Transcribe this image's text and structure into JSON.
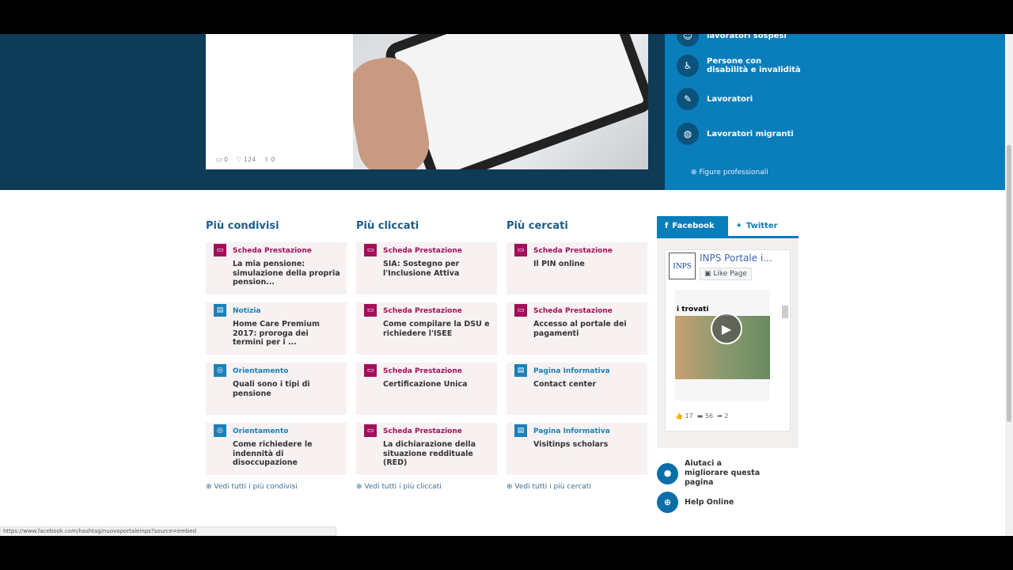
{
  "hero": {
    "social": {
      "comments": "0",
      "likes": "124",
      "shares": "0"
    }
  },
  "categories": [
    {
      "label": "lavoratori sospesi",
      "icon": "people-icon"
    },
    {
      "label": "Persone con disabilità e invalidità",
      "icon": "wheelchair-icon"
    },
    {
      "label": "Lavoratori",
      "icon": "wrench-icon"
    },
    {
      "label": "Lavoratori migranti",
      "icon": "globe-icon"
    }
  ],
  "figure_link": "Figure professionali",
  "columns": [
    {
      "title": "Più condivisi",
      "more": "Vedi tutti i più condivisi",
      "items": [
        {
          "type": "Scheda Prestazione",
          "title": "La mia pensione: simulazione della propria pension..."
        },
        {
          "type": "Notizia",
          "title": "Home Care Premium 2017: proroga dei termini per i ..."
        },
        {
          "type": "Orientamento",
          "title": "Quali sono i tipi di pensione"
        },
        {
          "type": "Orientamento",
          "title": "Come richiedere le indennità di disoccupazione"
        }
      ]
    },
    {
      "title": "Più cliccati",
      "more": "Vedi tutti i più cliccati",
      "items": [
        {
          "type": "Scheda Prestazione",
          "title": "SIA: Sostegno per l'Inclusione Attiva"
        },
        {
          "type": "Scheda Prestazione",
          "title": "Come compilare la DSU e richiedere l'ISEE"
        },
        {
          "type": "Scheda Prestazione",
          "title": "Certificazione Unica"
        },
        {
          "type": "Scheda Prestazione",
          "title": "La dichiarazione della situazione reddituale (RED)"
        }
      ]
    },
    {
      "title": "Più cercati",
      "more": "Vedi tutti i più cercati",
      "items": [
        {
          "type": "Scheda Prestazione",
          "title": "Il PIN online"
        },
        {
          "type": "Scheda Prestazione",
          "title": "Accesso al portale dei pagamenti"
        },
        {
          "type": "Pagina Informativa",
          "title": "Contact center"
        },
        {
          "type": "Pagina Informativa",
          "title": "Visitinps scholars"
        }
      ]
    }
  ],
  "colors": {
    "Scheda Prestazione": "#a2105c",
    "Notizia": "#1a80b8",
    "Orientamento": "#1a80b8",
    "Pagina Informativa": "#1a80b8"
  },
  "social_tabs": {
    "facebook": "Facebook",
    "twitter": "Twitter"
  },
  "fb": {
    "logo": "INPS",
    "page_name": "INPS Portale i...",
    "like": "Like Page",
    "post_title": "i trovati",
    "likes": "17",
    "comments": "56",
    "shares": "2"
  },
  "help": {
    "improve": "Aiutaci a migliorare questa pagina",
    "online": "Help Online"
  },
  "status_url": "https://www.facebook.com/hashtag/nuovoportaleinps?source=embed"
}
